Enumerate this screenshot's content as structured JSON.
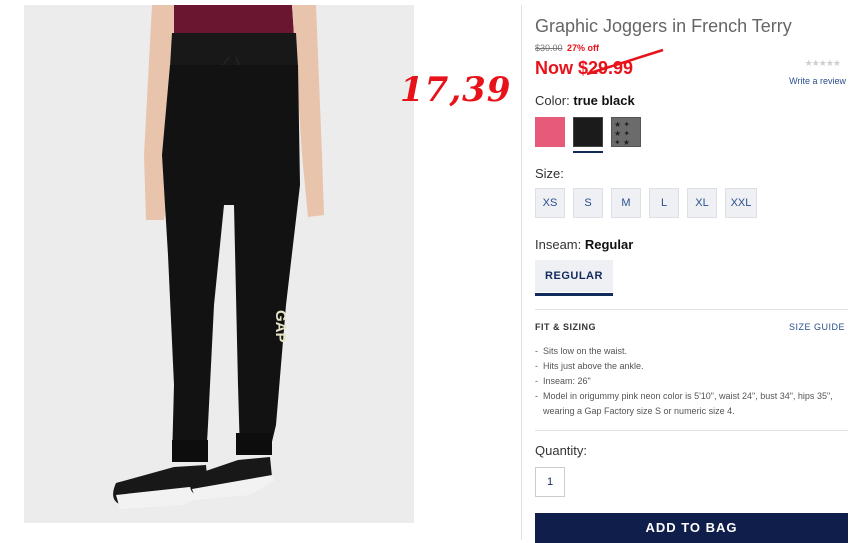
{
  "product": {
    "title": "Graphic Joggers in French Terry",
    "old_price": "$30.00",
    "discount": "27% off",
    "now_price": "Now $29.99",
    "handwritten_price": "17,39",
    "rating_stars": "★★★★★",
    "review_link": "Write a review"
  },
  "color": {
    "label": "Color:",
    "selected": "true black",
    "swatches": [
      "pink",
      "true black",
      "grey star print"
    ]
  },
  "size": {
    "label": "Size:",
    "options": [
      "XS",
      "S",
      "M",
      "L",
      "XL",
      "XXL"
    ]
  },
  "inseam": {
    "label": "Inseam:",
    "selected": "Regular",
    "option": "REGULAR"
  },
  "fit": {
    "title": "FIT & SIZING",
    "size_guide": "SIZE GUIDE",
    "bullets": [
      "Sits low on the waist.",
      "Hits just above the ankle.",
      "Inseam: 26\"",
      "Model in origummy pink neon color is 5'10\", waist 24\", bust 34\", hips 35\", wearing a Gap Factory size S or numeric size 4."
    ]
  },
  "quantity": {
    "label": "Quantity:",
    "value": "1"
  },
  "cta": {
    "add_to_bag": "ADD TO BAG"
  },
  "image": {
    "logo_text": "GAP"
  },
  "colors": {
    "accent_red": "#e8121b",
    "navy": "#0f1e4a",
    "link_blue": "#2a4f8f"
  }
}
